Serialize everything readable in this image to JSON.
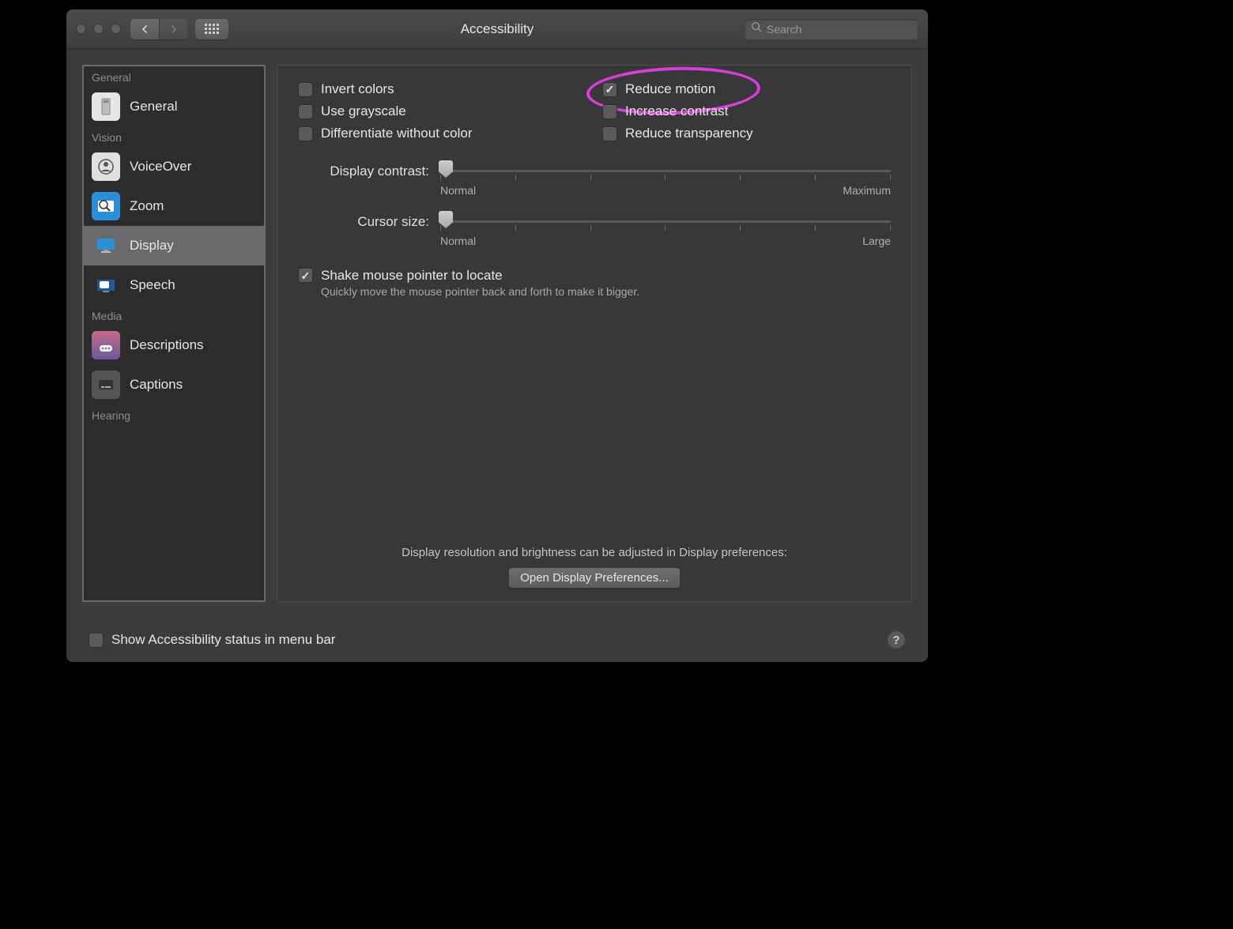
{
  "window": {
    "title": "Accessibility",
    "search_placeholder": "Search"
  },
  "sidebar": {
    "sections": [
      {
        "label": "General",
        "items": [
          {
            "label": "General"
          }
        ]
      },
      {
        "label": "Vision",
        "items": [
          {
            "label": "VoiceOver"
          },
          {
            "label": "Zoom"
          },
          {
            "label": "Display",
            "selected": true
          },
          {
            "label": "Speech"
          }
        ]
      },
      {
        "label": "Media",
        "items": [
          {
            "label": "Descriptions"
          },
          {
            "label": "Captions"
          }
        ]
      },
      {
        "label": "Hearing",
        "items": []
      }
    ]
  },
  "panel": {
    "checks": {
      "invert_colors": {
        "label": "Invert colors",
        "checked": false
      },
      "reduce_motion": {
        "label": "Reduce motion",
        "checked": true
      },
      "use_grayscale": {
        "label": "Use grayscale",
        "checked": false
      },
      "increase_contrast": {
        "label": "Increase contrast",
        "checked": false
      },
      "differentiate": {
        "label": "Differentiate without color",
        "checked": false
      },
      "reduce_transparency": {
        "label": "Reduce transparency",
        "checked": false
      }
    },
    "contrast": {
      "label": "Display contrast:",
      "min_label": "Normal",
      "max_label": "Maximum",
      "value_pct": 0
    },
    "cursor": {
      "label": "Cursor size:",
      "min_label": "Normal",
      "max_label": "Large",
      "value_pct": 0
    },
    "shake": {
      "checked": true,
      "heading": "Shake mouse pointer to locate",
      "sub": "Quickly move the mouse pointer back and forth to make it bigger."
    },
    "bottom_note": "Display resolution and brightness can be adjusted in Display preferences:",
    "open_button": "Open Display Preferences..."
  },
  "footer": {
    "show_status": {
      "label": "Show Accessibility status in menu bar",
      "checked": false
    },
    "help": "?"
  }
}
